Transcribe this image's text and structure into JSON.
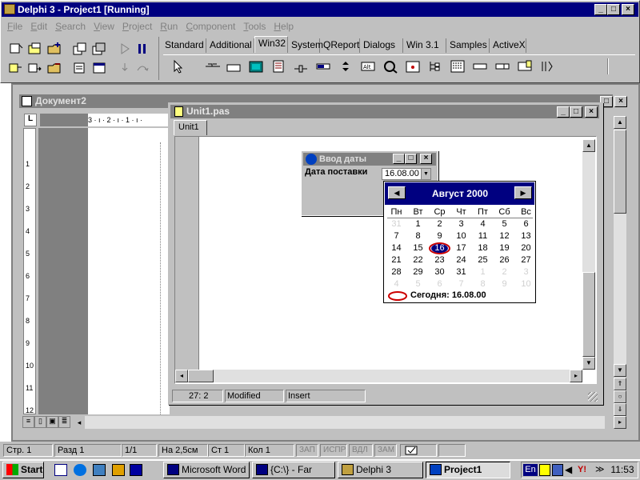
{
  "delphi": {
    "title": "Delphi 3 - Project1 [Running]",
    "menu": [
      {
        "pre": "",
        "u": "F",
        "post": "ile"
      },
      {
        "pre": "",
        "u": "E",
        "post": "dit"
      },
      {
        "pre": "",
        "u": "S",
        "post": "earch"
      },
      {
        "pre": "",
        "u": "V",
        "post": "iew"
      },
      {
        "pre": "",
        "u": "P",
        "post": "roject"
      },
      {
        "pre": "",
        "u": "R",
        "post": "un"
      },
      {
        "pre": "",
        "u": "C",
        "post": "omponent"
      },
      {
        "pre": "",
        "u": "T",
        "post": "ools"
      },
      {
        "pre": "",
        "u": "H",
        "post": "elp"
      }
    ],
    "palette_tabs": [
      "Standard",
      "Additional",
      "Win32",
      "System",
      "QReport",
      "Dialogs",
      "Win 3.1",
      "Samples",
      "ActiveX"
    ],
    "active_tab": "Win32"
  },
  "word": {
    "title": "Документ2",
    "ruler_top": "3 · ı · 2 · ı · 1 · ı ·",
    "ruler_left": [
      "1",
      "2",
      "3",
      "4",
      "5",
      "6",
      "7",
      "8",
      "9",
      "10",
      "11",
      "12"
    ],
    "status": {
      "page": "Стр. 1",
      "section": "Разд 1",
      "pages": "1/1",
      "at": "На 2,5см",
      "line": "Ст 1",
      "col": "Кол 1",
      "rec": "ЗАП",
      "trk": "ИСПР",
      "ext": "ВДЛ",
      "ovr": "ЗАМ"
    }
  },
  "editor": {
    "title": "Unit1.pas",
    "tab": "Unit1",
    "status_pos": "27:  2",
    "status_modified": "Modified",
    "status_mode": "Insert"
  },
  "dialog": {
    "title": "Ввод даты",
    "label": "Дата поставки",
    "value": "16.08.00"
  },
  "calendar": {
    "month_title": "Август 2000",
    "weekdays": [
      "Пн",
      "Вт",
      "Ср",
      "Чт",
      "Пт",
      "Сб",
      "Вс"
    ],
    "weeks": [
      [
        {
          "d": "31",
          "o": true
        },
        {
          "d": "1"
        },
        {
          "d": "2"
        },
        {
          "d": "3"
        },
        {
          "d": "4"
        },
        {
          "d": "5"
        },
        {
          "d": "6"
        }
      ],
      [
        {
          "d": "7"
        },
        {
          "d": "8"
        },
        {
          "d": "9"
        },
        {
          "d": "10"
        },
        {
          "d": "11"
        },
        {
          "d": "12"
        },
        {
          "d": "13"
        }
      ],
      [
        {
          "d": "14"
        },
        {
          "d": "15"
        },
        {
          "d": "16",
          "sel": true
        },
        {
          "d": "17"
        },
        {
          "d": "18"
        },
        {
          "d": "19"
        },
        {
          "d": "20"
        }
      ],
      [
        {
          "d": "21"
        },
        {
          "d": "22"
        },
        {
          "d": "23"
        },
        {
          "d": "24"
        },
        {
          "d": "25"
        },
        {
          "d": "26"
        },
        {
          "d": "27"
        }
      ],
      [
        {
          "d": "28"
        },
        {
          "d": "29"
        },
        {
          "d": "30"
        },
        {
          "d": "31"
        },
        {
          "d": "1",
          "o": true
        },
        {
          "d": "2",
          "o": true
        },
        {
          "d": "3",
          "o": true
        }
      ],
      [
        {
          "d": "4",
          "o": true
        },
        {
          "d": "5",
          "o": true
        },
        {
          "d": "6",
          "o": true
        },
        {
          "d": "7",
          "o": true
        },
        {
          "d": "8",
          "o": true
        },
        {
          "d": "9",
          "o": true
        },
        {
          "d": "10",
          "o": true
        }
      ]
    ],
    "today_label": "Сегодня: 16.08.00"
  },
  "taskbar": {
    "start": "Start",
    "tasks": [
      {
        "label": "Microsoft Word",
        "icon": "word-icon"
      },
      {
        "label": "{C:\\} - Far",
        "icon": "far-icon"
      },
      {
        "label": "Delphi 3",
        "icon": "delphi-icon"
      },
      {
        "label": "Project1",
        "icon": "project-icon",
        "pressed": true
      }
    ],
    "lang": "En",
    "clock": "11:53"
  },
  "colors": {
    "title_active": "#000080",
    "selection_circle": "#cc0000",
    "cal_header": "#000080"
  }
}
